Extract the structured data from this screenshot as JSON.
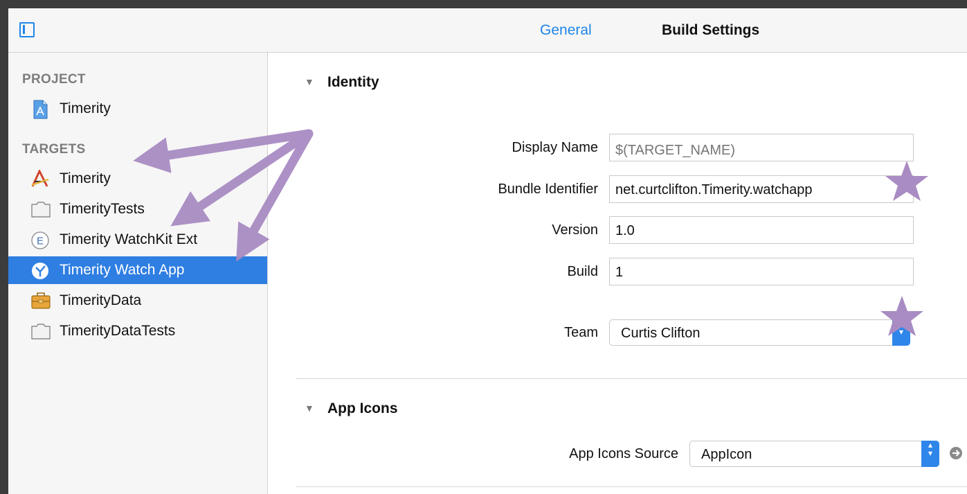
{
  "tabs": {
    "general": "General",
    "build_settings": "Build Settings"
  },
  "sidebar": {
    "project_header": "PROJECT",
    "project_item": "Timerity",
    "targets_header": "TARGETS",
    "targets": [
      {
        "label": "Timerity",
        "icon": "app-icon"
      },
      {
        "label": "TimerityTests",
        "icon": "test-bundle-icon"
      },
      {
        "label": "Timerity WatchKit Ext",
        "icon": "extension-icon"
      },
      {
        "label": "Timerity Watch App",
        "icon": "watch-app-icon",
        "selected": true
      },
      {
        "label": "TimerityData",
        "icon": "framework-icon"
      },
      {
        "label": "TimerityDataTests",
        "icon": "test-bundle-icon"
      }
    ]
  },
  "identity": {
    "title": "Identity",
    "display_name_label": "Display Name",
    "display_name_placeholder": "$(TARGET_NAME)",
    "bundle_id_label": "Bundle Identifier",
    "bundle_id_value": "net.curtclifton.Timerity.watchapp",
    "version_label": "Version",
    "version_value": "1.0",
    "build_label": "Build",
    "build_value": "1",
    "team_label": "Team",
    "team_value": "Curtis Clifton"
  },
  "app_icons": {
    "title": "App Icons",
    "source_label": "App Icons Source",
    "source_value": "AppIcon"
  },
  "colors": {
    "accent": "#2f7ee2",
    "annotation": "#a98cc3"
  }
}
